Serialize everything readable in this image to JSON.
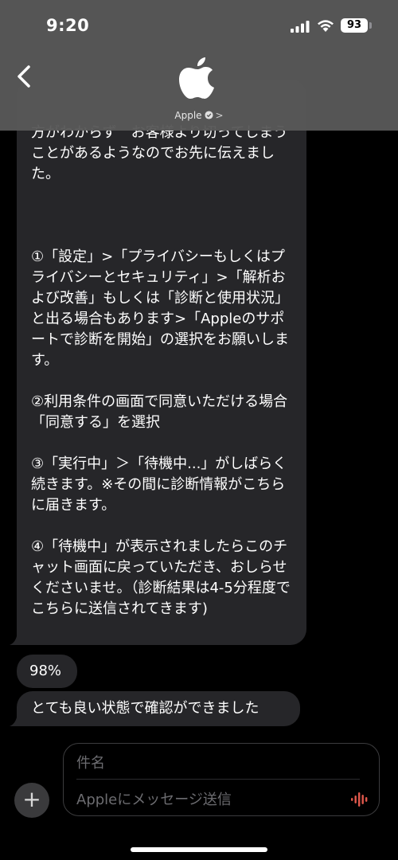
{
  "status_bar": {
    "time": "9:20",
    "battery": "93"
  },
  "header": {
    "contact_name": "Apple",
    "chevron": ">"
  },
  "messages": {
    "main_paragraphs": [
      "方がわからず　お客様より切ってしまうことがあるようなのでお先に伝えました。",
      "①「設定」>「プライバシーもしくはプライバシーとセキュリティ」>「解析および改善」もしくは「診断と使用状況」と出る場合もあります>「Appleのサポートで診断を開始」の選択をお願いします。",
      "②利用条件の画面で同意いただける場合「同意する」を選択",
      "③「実行中」＞「待機中...」がしばらく続きます。※その間に診断情報がこちらに届きます。",
      "④「待機中」が表示されましたらこのチャット画面に戻っていただき、おしらせくださいませ。（診断結果は4-5分程度でこちらに送信されてきます)"
    ],
    "short": "98%",
    "last": "とても良い状態で確認ができました"
  },
  "composer": {
    "add_label": "+",
    "subject_placeholder": "件名",
    "message_placeholder": "Appleにメッセージ送信"
  },
  "colors": {
    "header_bg": "#585858",
    "bubble_bg": "#262629",
    "mic_accent": "#e0584c"
  },
  "icons": [
    "back-chevron-icon",
    "apple-logo-icon",
    "verified-badge-icon",
    "signal-icon",
    "wifi-icon",
    "battery-icon",
    "plus-icon",
    "waveform-mic-icon"
  ]
}
